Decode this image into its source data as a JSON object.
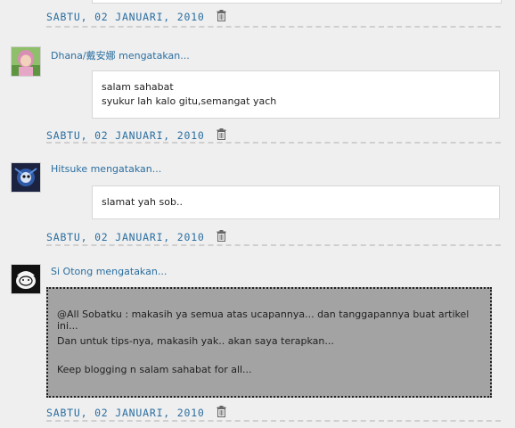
{
  "comments": [
    {
      "author": "Dhana/戴安娜",
      "says": "mengatakan...",
      "lines": [
        "salam sahabat",
        "syukur lah kalo gitu,semangat yach"
      ]
    },
    {
      "author": "Hitsuke",
      "says": "mengatakan...",
      "lines": [
        "slamat yah sob.."
      ]
    },
    {
      "author": "Si Otong",
      "says": "mengatakan...",
      "lines": [
        "@All Sobatku : makasih ya semua atas ucapannya... dan tanggapannya buat artikel ini...",
        "Dan untuk tips-nya, makasih yak.. akan saya terapkan...",
        "Keep blogging n salam sahabat for all..."
      ]
    }
  ],
  "dates": [
    "SABTU, 02 JANUARI, 2010",
    "SABTU, 02 JANUARI, 2010",
    "SABTU, 02 JANUARI, 2010",
    "SABTU, 02 JANUARI, 2010"
  ],
  "icons": {
    "delete": "trash-icon"
  },
  "colors": {
    "link": "#2a6ea0",
    "highlight_bg": "#a3a3a3",
    "page_bg": "#efefef"
  }
}
